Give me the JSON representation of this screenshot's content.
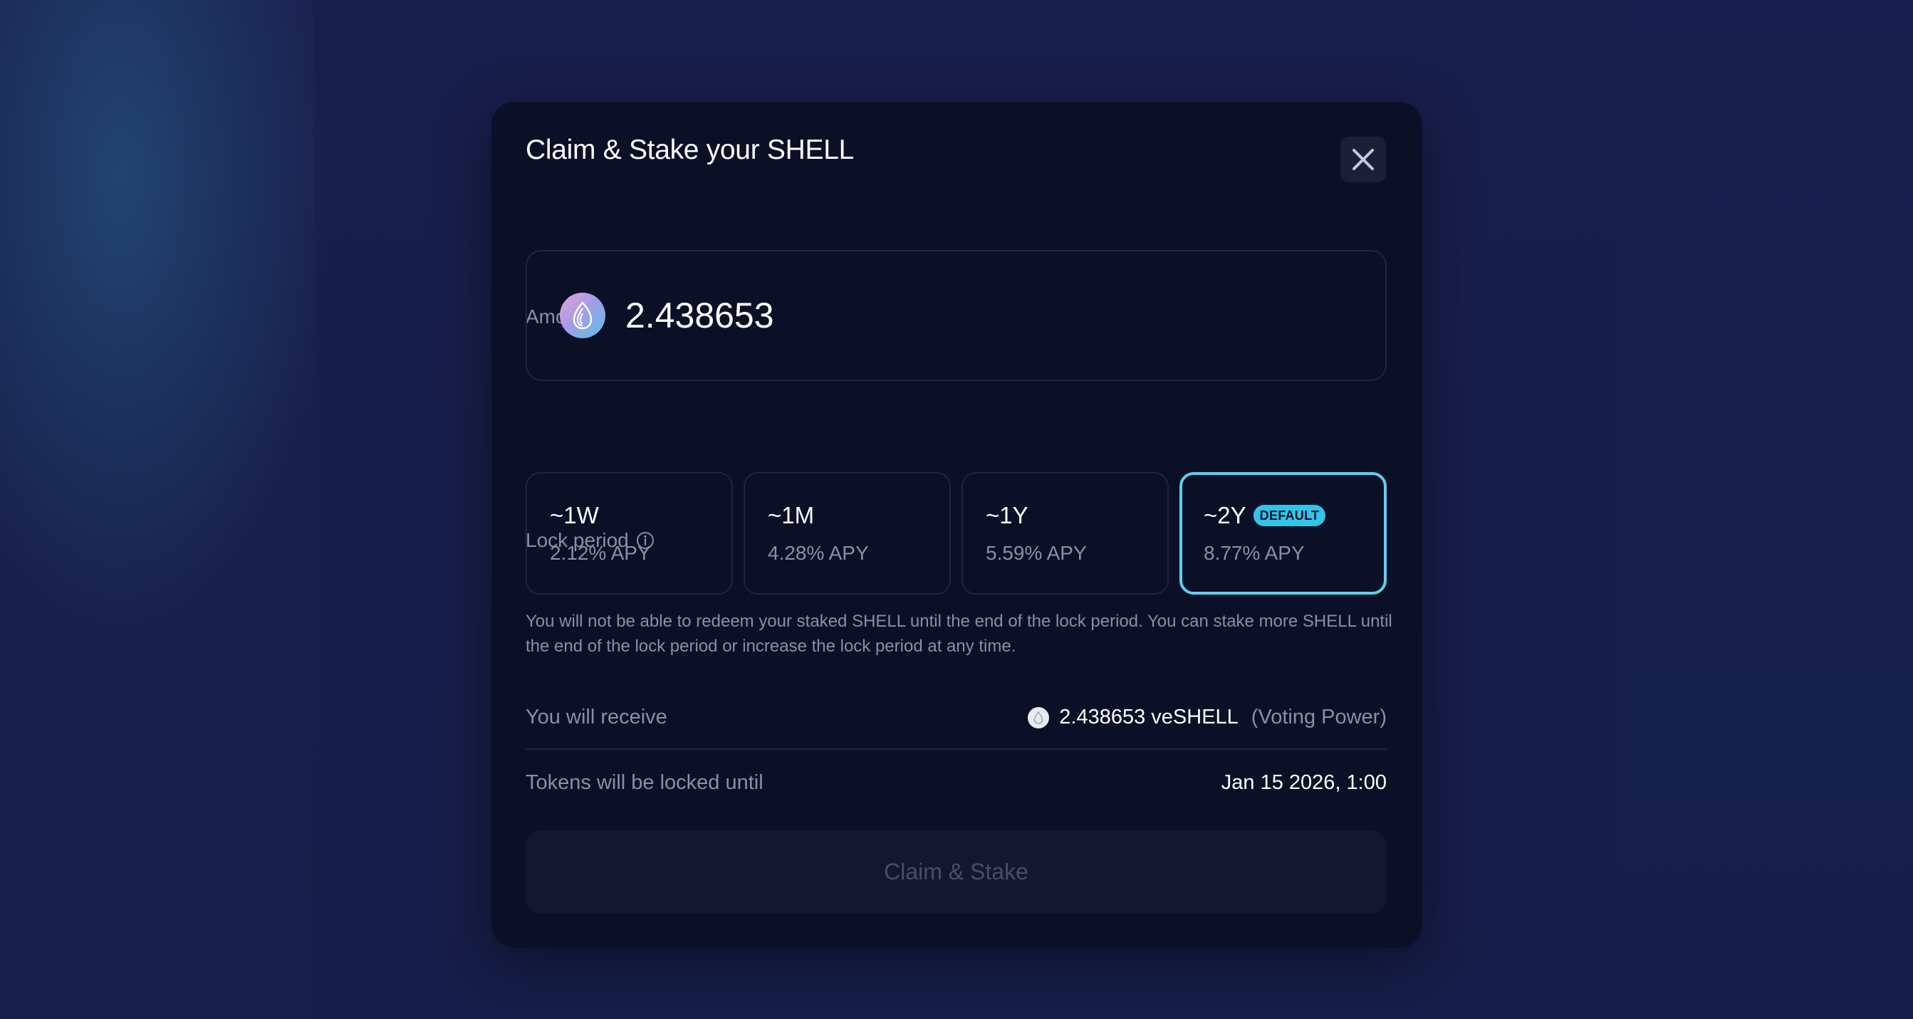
{
  "modal": {
    "title": "Claim & Stake your SHELL",
    "close_icon": "close-icon"
  },
  "amount": {
    "label": "Amount",
    "token_icon": "shell-token-icon",
    "value": "2.438653"
  },
  "lock_period": {
    "label": "Lock period",
    "info_icon": "info-icon",
    "options": [
      {
        "period": "~1W",
        "apy": "2.12% APY",
        "selected": false
      },
      {
        "period": "~1M",
        "apy": "4.28% APY",
        "selected": false
      },
      {
        "period": "~1Y",
        "apy": "5.59% APY",
        "selected": false
      },
      {
        "period": "~2Y",
        "apy": "8.77% APY",
        "selected": true,
        "badge": "DEFAULT"
      }
    ],
    "note": "You will not be able to redeem your staked SHELL until the end of the lock period. You can stake more SHELL until the end of the lock period or increase the lock period at any time."
  },
  "summary": {
    "receive_label": "You will receive",
    "receive_icon": "veshell-token-icon",
    "receive_amount": "2.438653 veSHELL",
    "receive_suffix": "(Voting Power)",
    "locked_label": "Tokens will be locked until",
    "locked_date": "Jan 15 2026, 1:00"
  },
  "action": {
    "button_label": "Claim & Stake",
    "disabled": true
  },
  "colors": {
    "modal_bg": "#0c1027",
    "accent": "#5fd0ee",
    "badge": "#33c4ea",
    "muted_text": "#8a8ea6"
  }
}
